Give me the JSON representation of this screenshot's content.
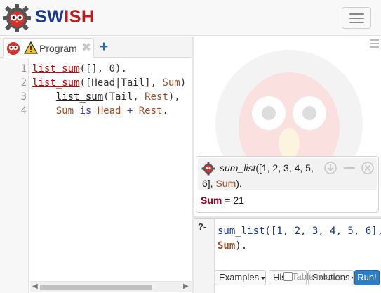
{
  "app": {
    "brand_part1": "SW",
    "brand_part2": "ISH"
  },
  "colors": {
    "brand_blue": "#1a3a8f",
    "brand_red": "#c0181b",
    "run_button": "#2d7dc8"
  },
  "icons": {
    "logo": "gear-owl-icon",
    "menu": "hamburger-icon",
    "tab_type": "owl-icon",
    "tab_warning": "warning-icon",
    "tab_close": "close-icon",
    "tab_add": "plus-icon"
  },
  "editor": {
    "tab_label": "Program",
    "tab_close_glyph": "✖",
    "tab_add_glyph": "+",
    "line_numbers": [
      "1",
      "2",
      "3",
      "4"
    ],
    "lines": [
      {
        "head": "list_sum",
        "rest": "([], 0)."
      },
      {
        "head": "list_sum",
        "p1": "([Head|Tail], ",
        "v1": "Sum",
        "p2": ") :-"
      },
      {
        "indent": "    ",
        "call": "list_sum",
        "p1": "(Tail, ",
        "v1": "Rest",
        "p2": "),"
      },
      {
        "indent": "    ",
        "v1": "Sum",
        "kw": " is ",
        "p1": "Head ",
        "op": "+",
        "v2": " Rest",
        "p2": "."
      }
    ]
  },
  "answer": {
    "func": "sum_list",
    "args_line1": "([1, 2, 3, 4, 5,",
    "args_line2_start": "6], ",
    "var": "Sum",
    "args_end": ").",
    "binding_var": "Sum",
    "binding_eq": " = ",
    "binding_value": "21"
  },
  "query": {
    "prompt": "?-",
    "line1": "sum_list([1, 2, 3, 4, 5, 6],",
    "line2_var": "Sum",
    "line2_end": ")."
  },
  "buttons": {
    "examples": "Examples",
    "history": "His",
    "solutions": "Solutions",
    "table_results": "Table results",
    "run": "Run!"
  }
}
